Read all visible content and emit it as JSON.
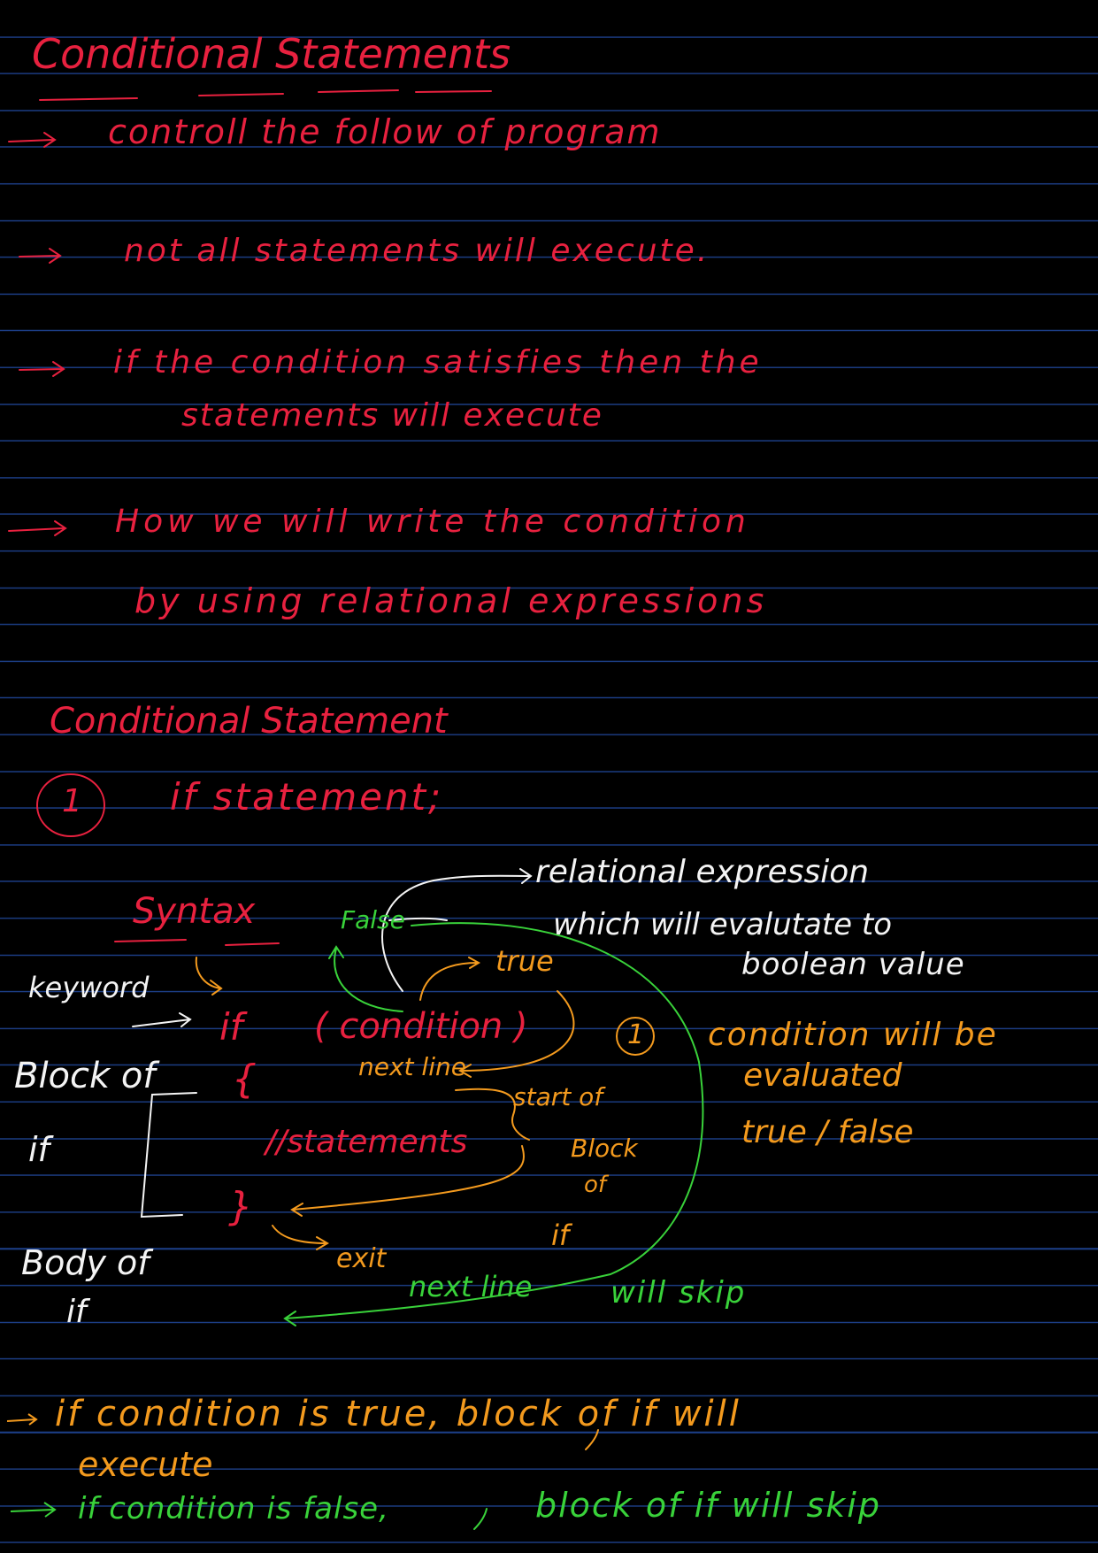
{
  "colors": {
    "background": "#000000",
    "rule_line": "#1c3e86",
    "red_ink": "#e8213f",
    "white_ink": "#f4f4f4",
    "orange_ink": "#f39a1e",
    "green_ink": "#39d23a"
  },
  "heading": "Conditional Statements",
  "bullets": [
    "controll the follow of program",
    "not all statements will execute.",
    "if the condition satisfies then the",
    "statements will execute",
    "How we will write the condition",
    "by using relational expressions"
  ],
  "subheading": "Conditional Statement",
  "item_number": "1",
  "item_title": "if statement;",
  "syntax": {
    "label": "Syntax",
    "relational_note_1": "relational expression",
    "relational_note_2": "which will evalutate to",
    "relational_note_3": "boolean value",
    "false_label": "False",
    "true_label": "true",
    "keyword_label": "keyword",
    "code_if": "if",
    "code_condition": "( condition )",
    "code_open_brace": "{",
    "code_statements": "//statements",
    "code_close_brace": "}",
    "next_line_1": "next line",
    "start_of": "start of",
    "block": "Block",
    "of": "of",
    "if_word": "if",
    "exit": "exit",
    "block_of": "Block of",
    "block_of_if": "if",
    "body_of": "Body of",
    "body_of_if": "if",
    "step_number": "1",
    "step_1": "condition will be",
    "step_2": "evaluated",
    "step_3": "true / false",
    "next_line_skip_1": "next line",
    "next_line_skip_2": "will skip"
  },
  "summary": [
    {
      "arrow": "→",
      "text": "if condition is true, block of if will"
    },
    {
      "arrow": "",
      "text": "execute"
    },
    {
      "arrow": "→",
      "text_a": "if condition is false,",
      "text_b": "block of if will skip"
    }
  ]
}
